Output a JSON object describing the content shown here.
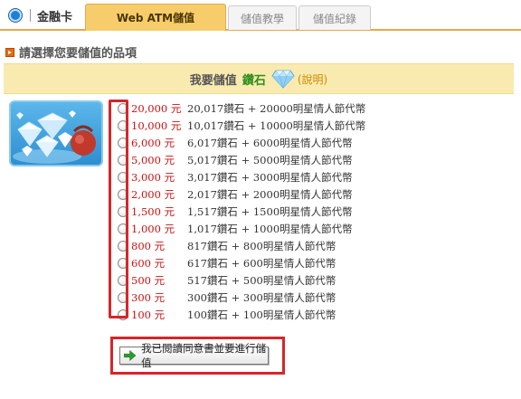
{
  "nav": {
    "brand_label": "金融卡",
    "tabs": [
      {
        "label": "Web ATM儲值",
        "active": true
      },
      {
        "label": "儲值教學",
        "active": false
      },
      {
        "label": "儲值紀錄",
        "active": false
      }
    ]
  },
  "section": {
    "title": "請選擇您要儲值的品項"
  },
  "header": {
    "prefix": "我要儲值",
    "item_name": "鑽石",
    "help_link": "(說明)"
  },
  "options": [
    {
      "price": "20,000 元",
      "description": "20,017鑽石 + 20000明星情人節代幣"
    },
    {
      "price": "10,000 元",
      "description": "10,017鑽石 + 10000明星情人節代幣"
    },
    {
      "price": "6,000 元",
      "description": "6,017鑽石 + 6000明星情人節代幣"
    },
    {
      "price": "5,000 元",
      "description": "5,017鑽石 + 5000明星情人節代幣"
    },
    {
      "price": "3,000 元",
      "description": "3,017鑽石 + 3000明星情人節代幣"
    },
    {
      "price": "2,000 元",
      "description": "2,017鑽石 + 2000明星情人節代幣"
    },
    {
      "price": "1,500 元",
      "description": "1,517鑽石 + 1500明星情人節代幣"
    },
    {
      "price": "1,000 元",
      "description": "1,017鑽石 + 1000明星情人節代幣"
    },
    {
      "price": "800 元",
      "description": "817鑽石 + 800明星情人節代幣"
    },
    {
      "price": "600 元",
      "description": "617鑽石 + 600明星情人節代幣"
    },
    {
      "price": "500 元",
      "description": "517鑽石 + 500明星情人節代幣"
    },
    {
      "price": "300 元",
      "description": "300鑽石 + 300明星情人節代幣"
    },
    {
      "price": "100 元",
      "description": "100鑽石 + 100明星情人節代幣"
    }
  ],
  "submit": {
    "label": "我已閱讀同意書並要進行儲值"
  },
  "colors": {
    "tab_active": "#f6cd6a",
    "price_red": "#cc1111",
    "item_green": "#2f8f1c",
    "highlight_red": "#d6262a",
    "band_yellow": "#f9eab0"
  },
  "icons": [
    "card-icon",
    "section-arrow-icon",
    "diamond-icon",
    "diamond-product-image",
    "green-arrow-icon"
  ]
}
